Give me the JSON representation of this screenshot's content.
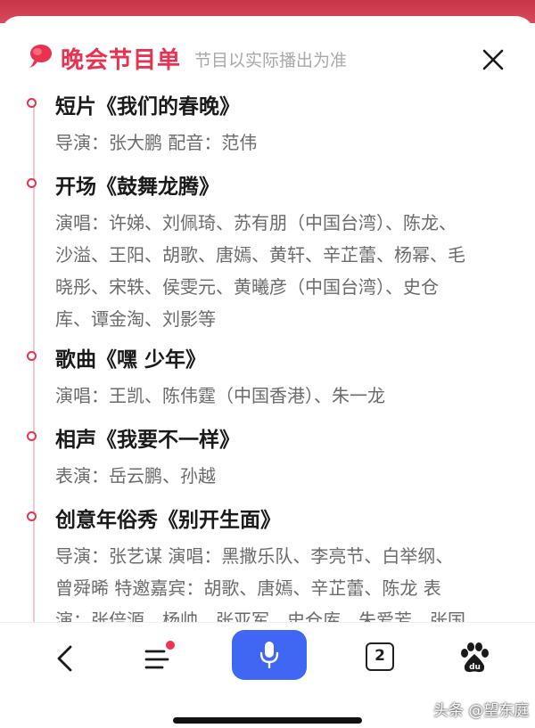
{
  "header": {
    "title": "晚会节目单",
    "subtitle": "节目以实际播出为准"
  },
  "programs": [
    {
      "title": "短片《我们的春晚》",
      "detail": "导演：张大鹏 配音：范伟"
    },
    {
      "title": "开场《鼓舞龙腾》",
      "detail": "演唱：许娣、刘佩琦、苏有朋（中国台湾）、陈龙、\n沙溢、王阳、胡歌、唐嫣、黄轩、辛芷蕾、杨幂、毛\n晓彤、宋轶、侯雯元、黄曦彦（中国台湾）、史仓\n库、谭金淘、刘影等"
    },
    {
      "title": "歌曲《嘿 少年》",
      "detail": "演唱：王凯、陈伟霆（中国香港）、朱一龙"
    },
    {
      "title": "相声《我要不一样》",
      "detail": "表演：岳云鹏、孙越"
    },
    {
      "title": "创意年俗秀《别开生面》",
      "detail": "导演：张艺谋 演唱：黑撒乐队、李亮节、白举纲、\n曾舜晞 特邀嘉宾：胡歌、唐嫣、辛芷蕾、陈龙 表\n演：张倍源、杨帅、张亚军、史仓库、朱爱芳、张国"
    }
  ],
  "bottom_nav": {
    "tabs_count": "2",
    "icons": [
      "back-icon",
      "menu-icon",
      "microphone-icon",
      "tabs-icon",
      "baidu-paw-icon"
    ]
  },
  "watermark": "头条 @望东庭",
  "colors": {
    "accent": "#e8324f",
    "mic": "#3f67f3",
    "badge": "#f2314f"
  }
}
